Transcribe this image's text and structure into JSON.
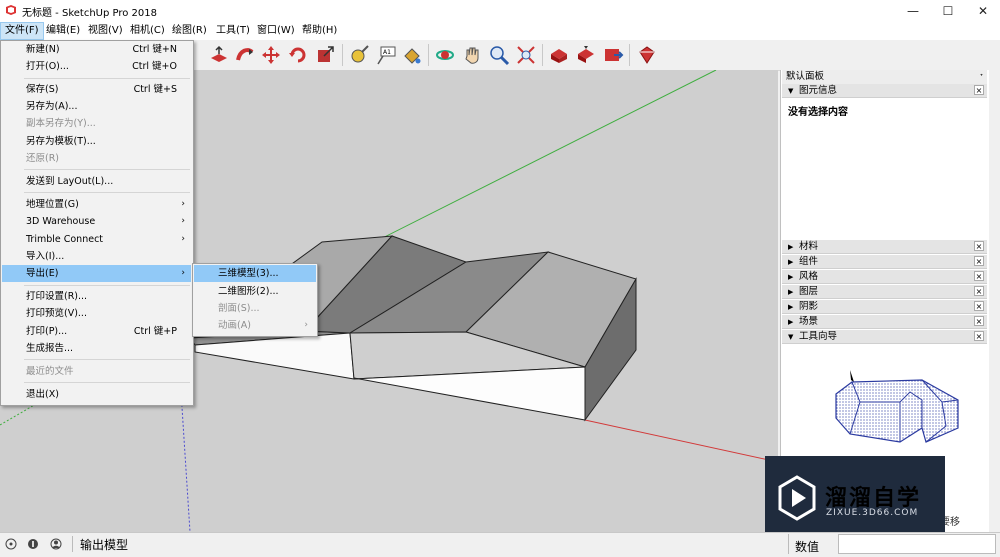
{
  "window": {
    "title": "无标题 - SketchUp Pro 2018",
    "min_glyph": "—",
    "max_glyph": "☐",
    "close_glyph": "✕"
  },
  "menubar": [
    {
      "label": "文件(F)"
    },
    {
      "label": "编辑(E)"
    },
    {
      "label": "视图(V)"
    },
    {
      "label": "相机(C)"
    },
    {
      "label": "绘图(R)"
    },
    {
      "label": "工具(T)"
    },
    {
      "label": "窗口(W)"
    },
    {
      "label": "帮助(H)"
    }
  ],
  "file_menu": [
    {
      "label": "新建(N)",
      "shortcut": "Ctrl 键+N"
    },
    {
      "label": "打开(O)...",
      "shortcut": "Ctrl 键+O"
    },
    {
      "label": "保存(S)",
      "shortcut": "Ctrl 键+S"
    },
    {
      "label": "另存为(A)...",
      "shortcut": ""
    },
    {
      "label": "副本另存为(Y)...",
      "shortcut": ""
    },
    {
      "label": "另存为模板(T)...",
      "shortcut": ""
    },
    {
      "label": "还原(R)",
      "shortcut": ""
    },
    {
      "label": "发送到 LayOut(L)...",
      "shortcut": ""
    },
    {
      "label": "地理位置(G)",
      "shortcut": ""
    },
    {
      "label": "3D Warehouse",
      "shortcut": ""
    },
    {
      "label": "Trimble Connect",
      "shortcut": ""
    },
    {
      "label": "导入(I)...",
      "shortcut": ""
    },
    {
      "label": "导出(E)",
      "shortcut": ""
    },
    {
      "label": "打印设置(R)...",
      "shortcut": ""
    },
    {
      "label": "打印预览(V)...",
      "shortcut": ""
    },
    {
      "label": "打印(P)...",
      "shortcut": "Ctrl 键+P"
    },
    {
      "label": "生成报告...",
      "shortcut": ""
    },
    {
      "label": "最近的文件",
      "shortcut": ""
    },
    {
      "label": "退出(X)",
      "shortcut": ""
    }
  ],
  "export_submenu": [
    {
      "label": "三维模型(3)..."
    },
    {
      "label": "二维图形(2)..."
    },
    {
      "label": "剖面(S)..."
    },
    {
      "label": "动画(A)"
    }
  ],
  "arrow_glyph": "›",
  "tray": {
    "title": "默认面板",
    "pin_glyph": "ᐩ",
    "close_glyph": "×",
    "entity_info": {
      "name": "图元信息",
      "content": "没有选择内容"
    },
    "panels": [
      {
        "name": "材料"
      },
      {
        "name": "组件"
      },
      {
        "name": "风格"
      },
      {
        "name": "图层"
      },
      {
        "name": "阴影"
      },
      {
        "name": "场景"
      }
    ],
    "instructor": {
      "name": "工具向导",
      "partial_text": "要移"
    },
    "expanded_glyph": "▼",
    "collapsed_glyph": "▶"
  },
  "statusbar": {
    "text": "输出模型",
    "measurements_label": "数值"
  },
  "watermark": {
    "main": "溜溜自学",
    "sub": "ZIXUE.3D66.COM"
  },
  "colors": {
    "menu_highlight": "#91c9f7",
    "axis_green": "#3fae3f",
    "axis_red": "#d23a3a",
    "axis_blue": "#4b4bd0",
    "selection_blue": "#2b3aa0"
  }
}
